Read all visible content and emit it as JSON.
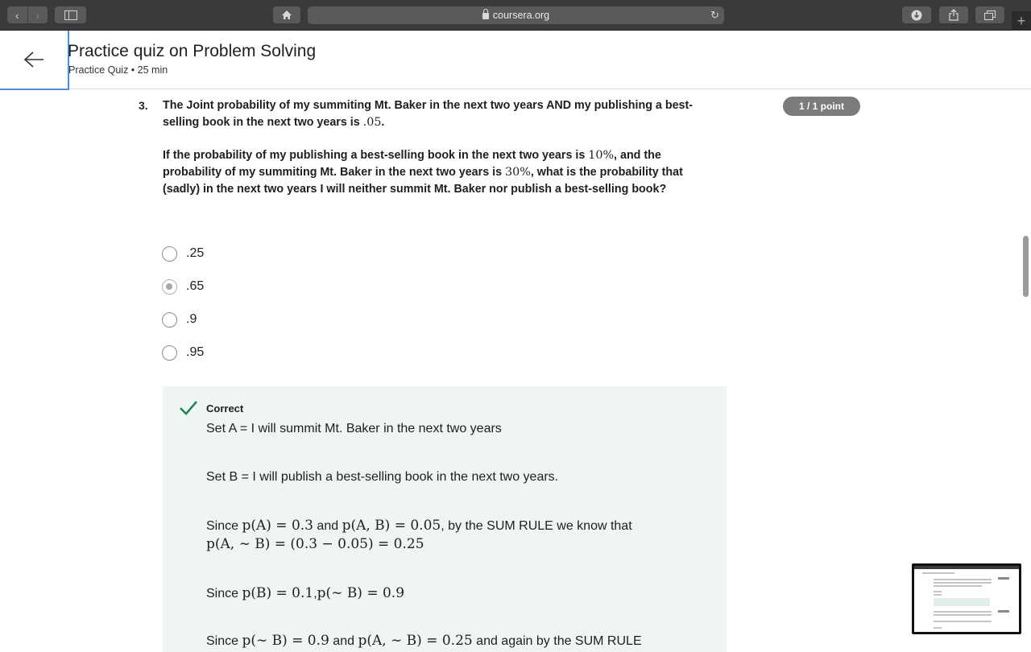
{
  "browser": {
    "url": "coursera.org",
    "back_icon": "chevron-left-icon",
    "forward_icon": "chevron-right-icon"
  },
  "header": {
    "title": "Practice quiz on Problem Solving",
    "subtitle": "Practice Quiz • 25 min"
  },
  "question": {
    "number": "3.",
    "para1_a": "The Joint probability of my summiting Mt. Baker in the next two years AND my publishing a best-selling book in the next two years is ",
    "para1_math": ".05",
    "para1_b": ".",
    "para2_a": "If the probability of my publishing a best-selling book in the next two years is ",
    "para2_m1": "10%",
    "para2_b": ", and the probability of my summiting Mt. Baker in the next two years is ",
    "para2_m2": "30%",
    "para2_c": ", what is the probability that (sadly) in the next two years I will neither summit Mt. Baker nor publish a best-selling book?",
    "points": "1 / 1 point",
    "options": [
      ".25",
      ".65",
      ".9",
      ".95"
    ],
    "selected_index": 1
  },
  "feedback": {
    "status": "Correct",
    "line1": "Set A = I will summit Mt. Baker in the next two years",
    "line2": "Set B = I will publish a best-selling book in the next two years.",
    "line3_a": "Since ",
    "line3_m1": "p(A) = 0.3",
    "line3_b": " and ",
    "line3_m2": "p(A, B) = 0.05",
    "line3_c": ", by the SUM RULE we know that",
    "line4_m": "p(A, ∼ B) = (0.3 − 0.05) = 0.25",
    "line5_a": "Since ",
    "line5_m1": "p(B) = 0.1",
    "line5_b": ",",
    "line5_m2": "p(∼ B) = 0.9",
    "line6_a": "Since ",
    "line6_m1": "p(∼ B) = 0.9",
    "line6_b": " and ",
    "line6_m2": "p(A, ∼ B) = 0.25",
    "line6_c": " and again by the SUM RULE"
  },
  "colors": {
    "chrome": "#3a3a3c",
    "points_badge": "#7b7b7b",
    "feedback_bg": "#eef5f2",
    "check": "#1f8354",
    "focus": "#4d8fd8"
  }
}
